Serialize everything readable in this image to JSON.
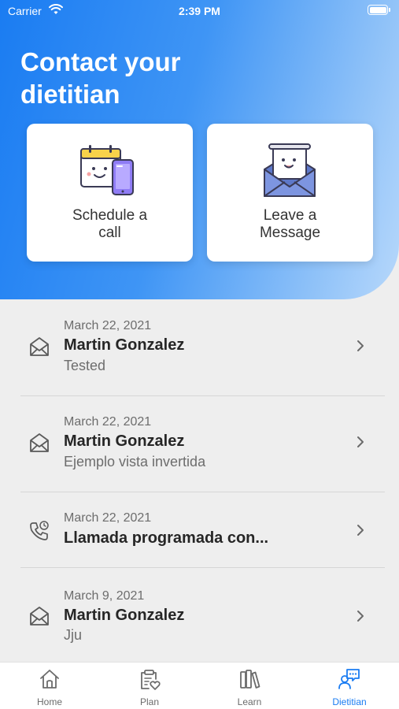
{
  "status_bar": {
    "carrier": "Carrier",
    "time": "2:39 PM"
  },
  "header": {
    "title": "Contact your dietitian"
  },
  "actions": {
    "schedule": {
      "label_line1": "Schedule a",
      "label_line2": "call",
      "icon": "calendar-phone-illustration"
    },
    "message": {
      "label_line1": "Leave a",
      "label_line2": "Message",
      "icon": "envelope-letter-illustration"
    }
  },
  "messages": [
    {
      "type": "message",
      "icon": "envelope-icon",
      "date": "March 22, 2021",
      "name": "Martin Gonzalez",
      "preview": "Tested"
    },
    {
      "type": "message",
      "icon": "envelope-icon",
      "date": "March 22, 2021",
      "name": "Martin Gonzalez",
      "preview": "Ejemplo vista invertida"
    },
    {
      "type": "call",
      "icon": "phone-clock-icon",
      "date": "March 22, 2021",
      "name": "Llamada programada con...",
      "preview": ""
    },
    {
      "type": "message",
      "icon": "envelope-icon",
      "date": "March 9, 2021",
      "name": "Martin Gonzalez",
      "preview": "Jju"
    }
  ],
  "tabbar": {
    "tabs": [
      {
        "label": "Home",
        "icon": "house-icon",
        "active": false
      },
      {
        "label": "Plan",
        "icon": "clipboard-heart-icon",
        "active": false
      },
      {
        "label": "Learn",
        "icon": "books-icon",
        "active": false
      },
      {
        "label": "Dietitian",
        "icon": "dietitian-chat-icon",
        "active": true
      }
    ]
  },
  "colors": {
    "accent": "#1a7cf2",
    "hero_start": "#1a7cf2",
    "hero_end": "#b7d8fb",
    "background": "#eeeeee"
  }
}
